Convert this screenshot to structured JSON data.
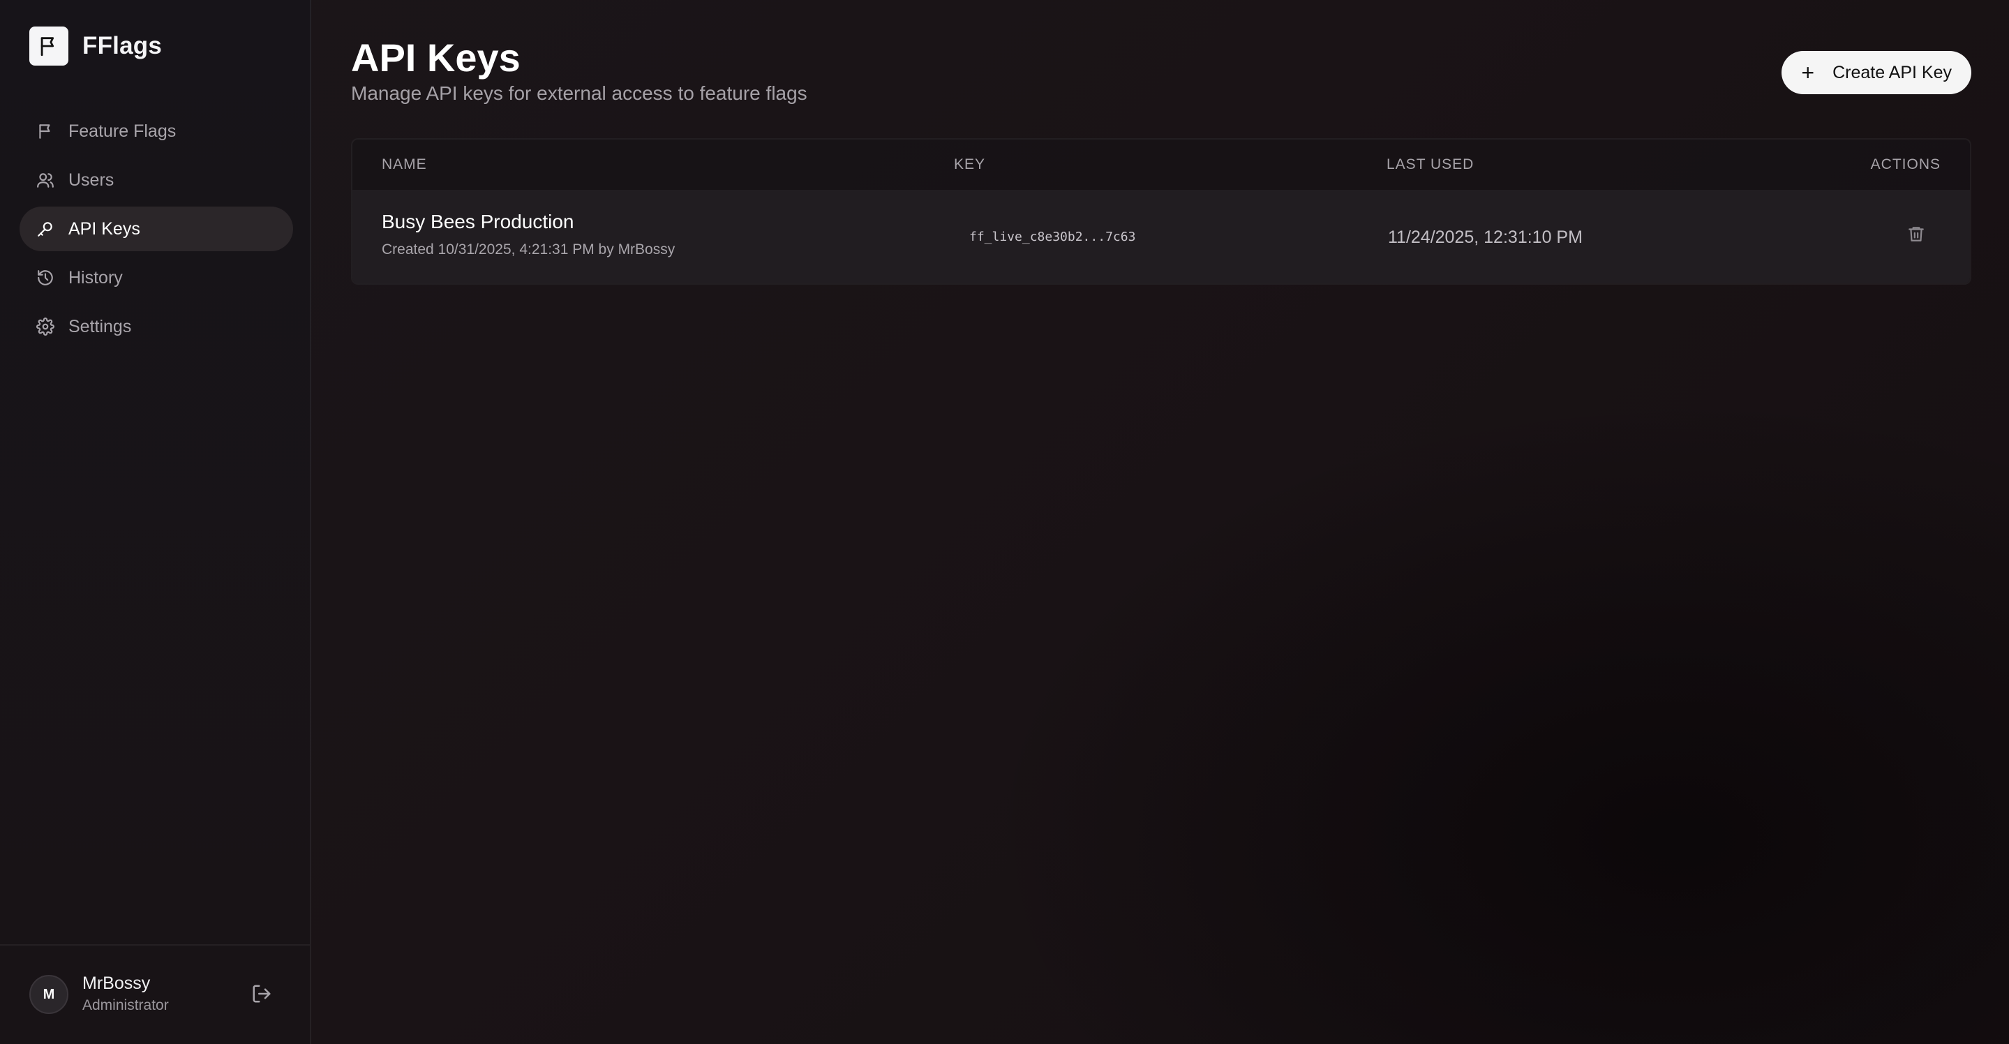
{
  "app": {
    "name": "FFlags"
  },
  "sidebar": {
    "items": [
      {
        "label": "Feature Flags",
        "icon": "flag-icon"
      },
      {
        "label": "Users",
        "icon": "users-icon"
      },
      {
        "label": "API Keys",
        "icon": "key-icon",
        "active": true
      },
      {
        "label": "History",
        "icon": "history-icon"
      },
      {
        "label": "Settings",
        "icon": "gear-icon"
      }
    ]
  },
  "user": {
    "initial": "M",
    "name": "MrBossy",
    "role": "Administrator"
  },
  "page": {
    "title": "API Keys",
    "subtitle": "Manage API keys for external access to feature flags",
    "create_button": "Create API Key"
  },
  "table": {
    "columns": [
      "NAME",
      "KEY",
      "LAST USED",
      "ACTIONS"
    ],
    "rows": [
      {
        "name": "Busy Bees Production",
        "created": "Created 10/31/2025, 4:21:31 PM by MrBossy",
        "key": "ff_live_c8e30b2...7c63",
        "last_used": "11/24/2025, 12:31:10 PM"
      }
    ]
  },
  "colors": {
    "accent": "#f5f5f5",
    "active_nav_bg": "#2b2629",
    "background": "#1a1316"
  }
}
